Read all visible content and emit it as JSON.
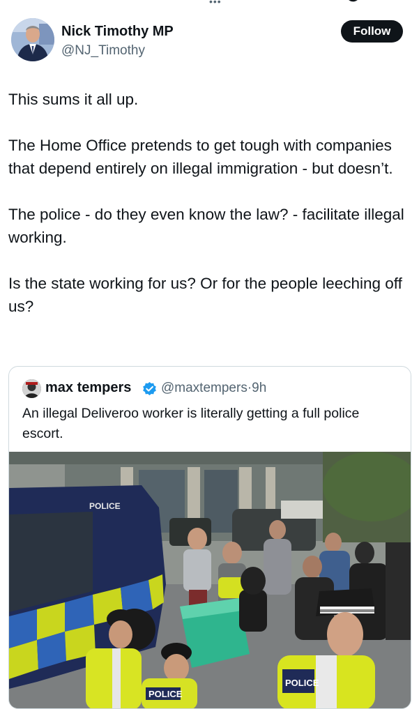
{
  "post": {
    "author_name": "Nick Timothy MP",
    "author_handle": "@NJ_Timothy",
    "follow_label": "Follow",
    "paragraphs": [
      "This sums it all up.",
      "The Home Office pretends to get tough with companies that depend entirely on illegal immigration - but doesn’t.",
      "The police - do they even know the law? - facilitate illegal working.",
      "Is the state working for us? Or for the people leeching off us?"
    ]
  },
  "quoted_post": {
    "author_name": "max tempers",
    "author_handle": "@maxtempers",
    "time": "9h",
    "separator": "·",
    "text": "An illegal Deliveroo worker is literally getting a full police escort.",
    "media": {
      "van_label": "POLICE",
      "vest_label_1": "POLICE",
      "vest_label_2": "POLICE"
    }
  },
  "colors": {
    "text_primary": "#0f1419",
    "text_secondary": "#536471",
    "follow_bg": "#0f1419",
    "verified_blue": "#1d9bf0",
    "border": "#cfd9de"
  },
  "icons": {
    "verified": "verified-badge-icon"
  }
}
